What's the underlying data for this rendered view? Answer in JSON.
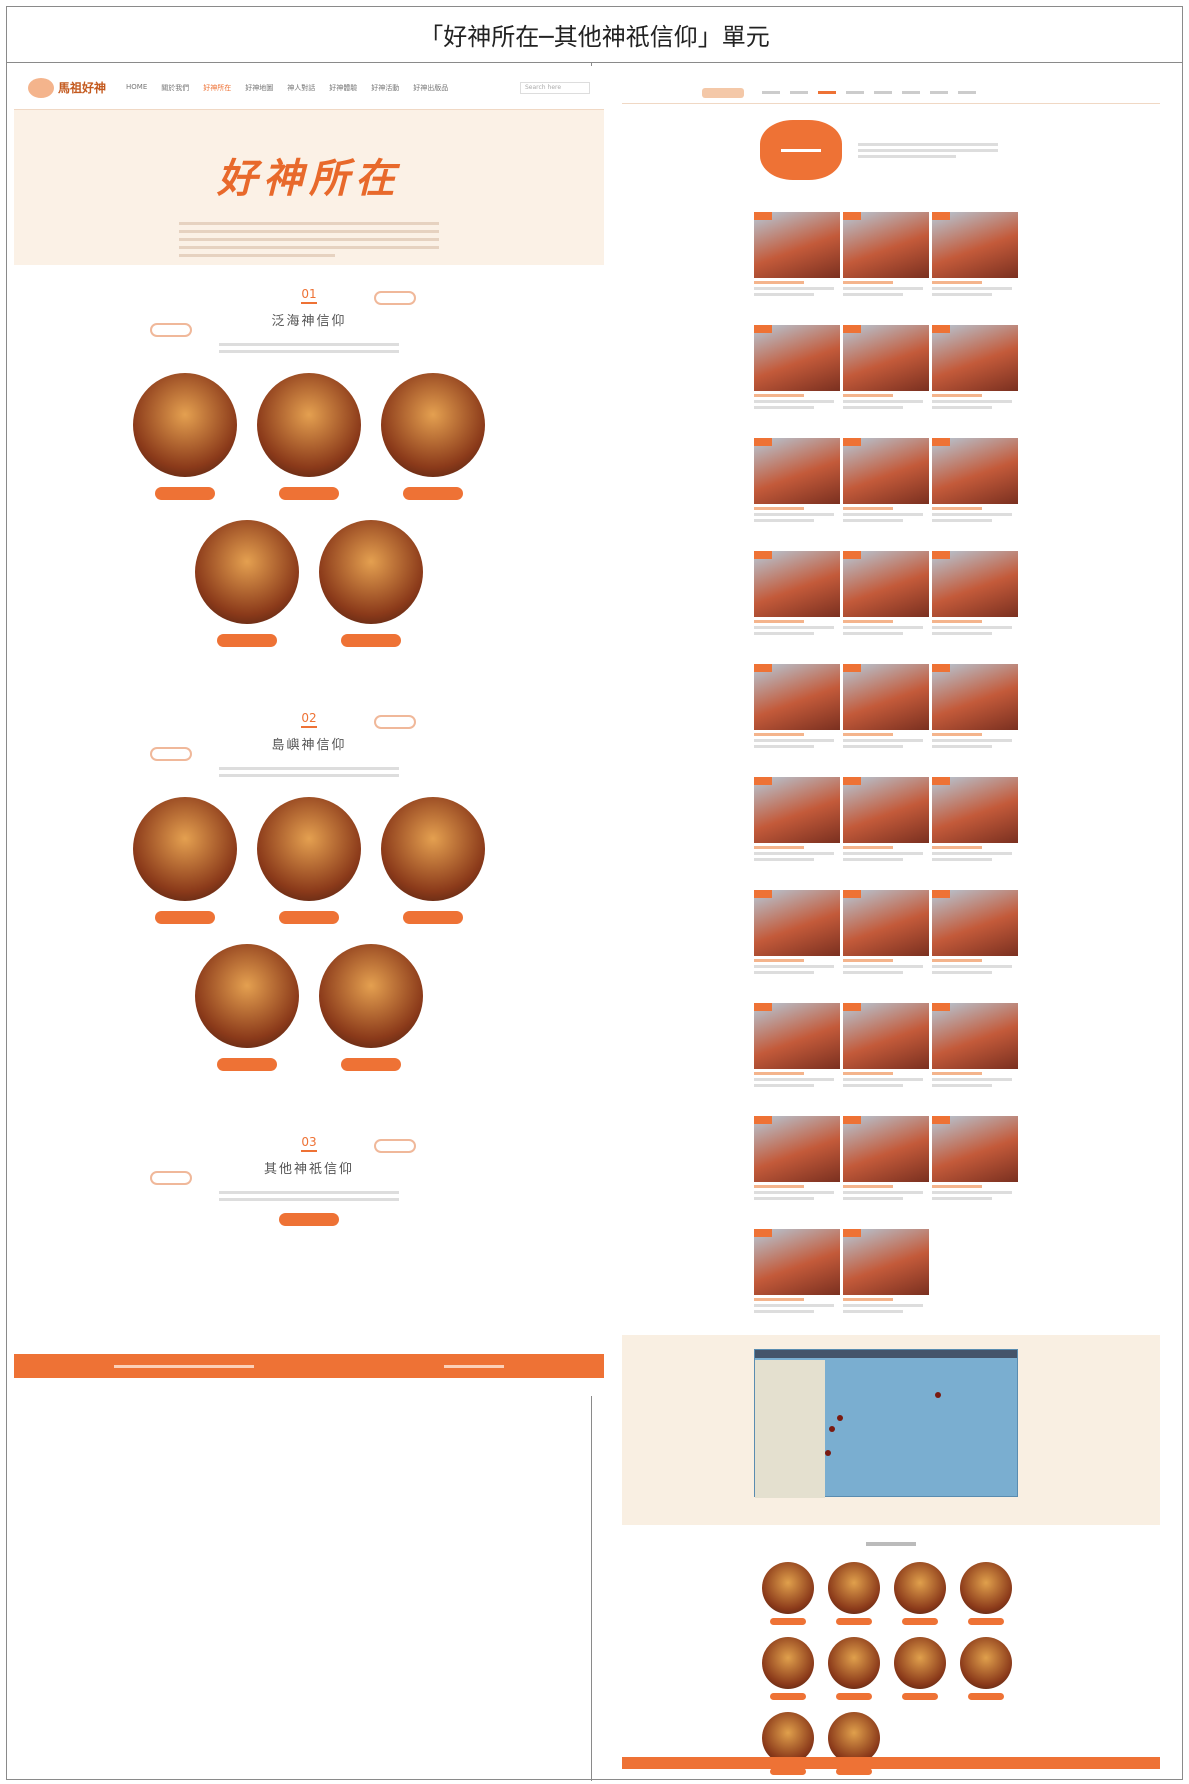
{
  "caption": "「好神所在─其他神祇信仰」單元",
  "left_page": {
    "logo": "馬祖好神",
    "nav": [
      "HOME",
      "關於我們",
      "好神所在",
      "好神地圖",
      "神人對話",
      "好神體驗",
      "好神活動",
      "好神出版品"
    ],
    "nav_active_index": 2,
    "search_placeholder": "Search here",
    "hero": {
      "title": "好神所在"
    },
    "sections": [
      {
        "num": "01",
        "title": "泛海神信仰",
        "pill_count": 5,
        "rows": [
          3,
          2
        ]
      },
      {
        "num": "02",
        "title": "島嶼神信仰",
        "pill_count": 5,
        "rows": [
          3,
          2
        ]
      },
      {
        "num": "03",
        "title": "其他神祇信仰",
        "pill_count": 1,
        "rows": [
          0
        ]
      }
    ]
  },
  "right_page": {
    "temple_cards": 29,
    "god_circles": 10
  },
  "colors": {
    "accent": "#ee7235",
    "hero_bg": "#fbf1e6"
  }
}
